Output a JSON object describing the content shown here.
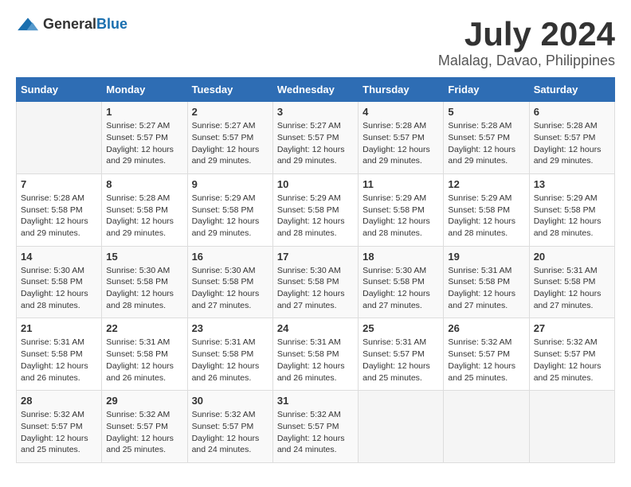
{
  "header": {
    "logo_general": "General",
    "logo_blue": "Blue",
    "month": "July 2024",
    "location": "Malalag, Davao, Philippines"
  },
  "calendar": {
    "days_of_week": [
      "Sunday",
      "Monday",
      "Tuesday",
      "Wednesday",
      "Thursday",
      "Friday",
      "Saturday"
    ],
    "weeks": [
      [
        {
          "day": "",
          "info": ""
        },
        {
          "day": "1",
          "info": "Sunrise: 5:27 AM\nSunset: 5:57 PM\nDaylight: 12 hours\nand 29 minutes."
        },
        {
          "day": "2",
          "info": "Sunrise: 5:27 AM\nSunset: 5:57 PM\nDaylight: 12 hours\nand 29 minutes."
        },
        {
          "day": "3",
          "info": "Sunrise: 5:27 AM\nSunset: 5:57 PM\nDaylight: 12 hours\nand 29 minutes."
        },
        {
          "day": "4",
          "info": "Sunrise: 5:28 AM\nSunset: 5:57 PM\nDaylight: 12 hours\nand 29 minutes."
        },
        {
          "day": "5",
          "info": "Sunrise: 5:28 AM\nSunset: 5:57 PM\nDaylight: 12 hours\nand 29 minutes."
        },
        {
          "day": "6",
          "info": "Sunrise: 5:28 AM\nSunset: 5:57 PM\nDaylight: 12 hours\nand 29 minutes."
        }
      ],
      [
        {
          "day": "7",
          "info": "Sunrise: 5:28 AM\nSunset: 5:58 PM\nDaylight: 12 hours\nand 29 minutes."
        },
        {
          "day": "8",
          "info": "Sunrise: 5:28 AM\nSunset: 5:58 PM\nDaylight: 12 hours\nand 29 minutes."
        },
        {
          "day": "9",
          "info": "Sunrise: 5:29 AM\nSunset: 5:58 PM\nDaylight: 12 hours\nand 29 minutes."
        },
        {
          "day": "10",
          "info": "Sunrise: 5:29 AM\nSunset: 5:58 PM\nDaylight: 12 hours\nand 28 minutes."
        },
        {
          "day": "11",
          "info": "Sunrise: 5:29 AM\nSunset: 5:58 PM\nDaylight: 12 hours\nand 28 minutes."
        },
        {
          "day": "12",
          "info": "Sunrise: 5:29 AM\nSunset: 5:58 PM\nDaylight: 12 hours\nand 28 minutes."
        },
        {
          "day": "13",
          "info": "Sunrise: 5:29 AM\nSunset: 5:58 PM\nDaylight: 12 hours\nand 28 minutes."
        }
      ],
      [
        {
          "day": "14",
          "info": "Sunrise: 5:30 AM\nSunset: 5:58 PM\nDaylight: 12 hours\nand 28 minutes."
        },
        {
          "day": "15",
          "info": "Sunrise: 5:30 AM\nSunset: 5:58 PM\nDaylight: 12 hours\nand 28 minutes."
        },
        {
          "day": "16",
          "info": "Sunrise: 5:30 AM\nSunset: 5:58 PM\nDaylight: 12 hours\nand 27 minutes."
        },
        {
          "day": "17",
          "info": "Sunrise: 5:30 AM\nSunset: 5:58 PM\nDaylight: 12 hours\nand 27 minutes."
        },
        {
          "day": "18",
          "info": "Sunrise: 5:30 AM\nSunset: 5:58 PM\nDaylight: 12 hours\nand 27 minutes."
        },
        {
          "day": "19",
          "info": "Sunrise: 5:31 AM\nSunset: 5:58 PM\nDaylight: 12 hours\nand 27 minutes."
        },
        {
          "day": "20",
          "info": "Sunrise: 5:31 AM\nSunset: 5:58 PM\nDaylight: 12 hours\nand 27 minutes."
        }
      ],
      [
        {
          "day": "21",
          "info": "Sunrise: 5:31 AM\nSunset: 5:58 PM\nDaylight: 12 hours\nand 26 minutes."
        },
        {
          "day": "22",
          "info": "Sunrise: 5:31 AM\nSunset: 5:58 PM\nDaylight: 12 hours\nand 26 minutes."
        },
        {
          "day": "23",
          "info": "Sunrise: 5:31 AM\nSunset: 5:58 PM\nDaylight: 12 hours\nand 26 minutes."
        },
        {
          "day": "24",
          "info": "Sunrise: 5:31 AM\nSunset: 5:58 PM\nDaylight: 12 hours\nand 26 minutes."
        },
        {
          "day": "25",
          "info": "Sunrise: 5:31 AM\nSunset: 5:57 PM\nDaylight: 12 hours\nand 25 minutes."
        },
        {
          "day": "26",
          "info": "Sunrise: 5:32 AM\nSunset: 5:57 PM\nDaylight: 12 hours\nand 25 minutes."
        },
        {
          "day": "27",
          "info": "Sunrise: 5:32 AM\nSunset: 5:57 PM\nDaylight: 12 hours\nand 25 minutes."
        }
      ],
      [
        {
          "day": "28",
          "info": "Sunrise: 5:32 AM\nSunset: 5:57 PM\nDaylight: 12 hours\nand 25 minutes."
        },
        {
          "day": "29",
          "info": "Sunrise: 5:32 AM\nSunset: 5:57 PM\nDaylight: 12 hours\nand 25 minutes."
        },
        {
          "day": "30",
          "info": "Sunrise: 5:32 AM\nSunset: 5:57 PM\nDaylight: 12 hours\nand 24 minutes."
        },
        {
          "day": "31",
          "info": "Sunrise: 5:32 AM\nSunset: 5:57 PM\nDaylight: 12 hours\nand 24 minutes."
        },
        {
          "day": "",
          "info": ""
        },
        {
          "day": "",
          "info": ""
        },
        {
          "day": "",
          "info": ""
        }
      ]
    ]
  }
}
